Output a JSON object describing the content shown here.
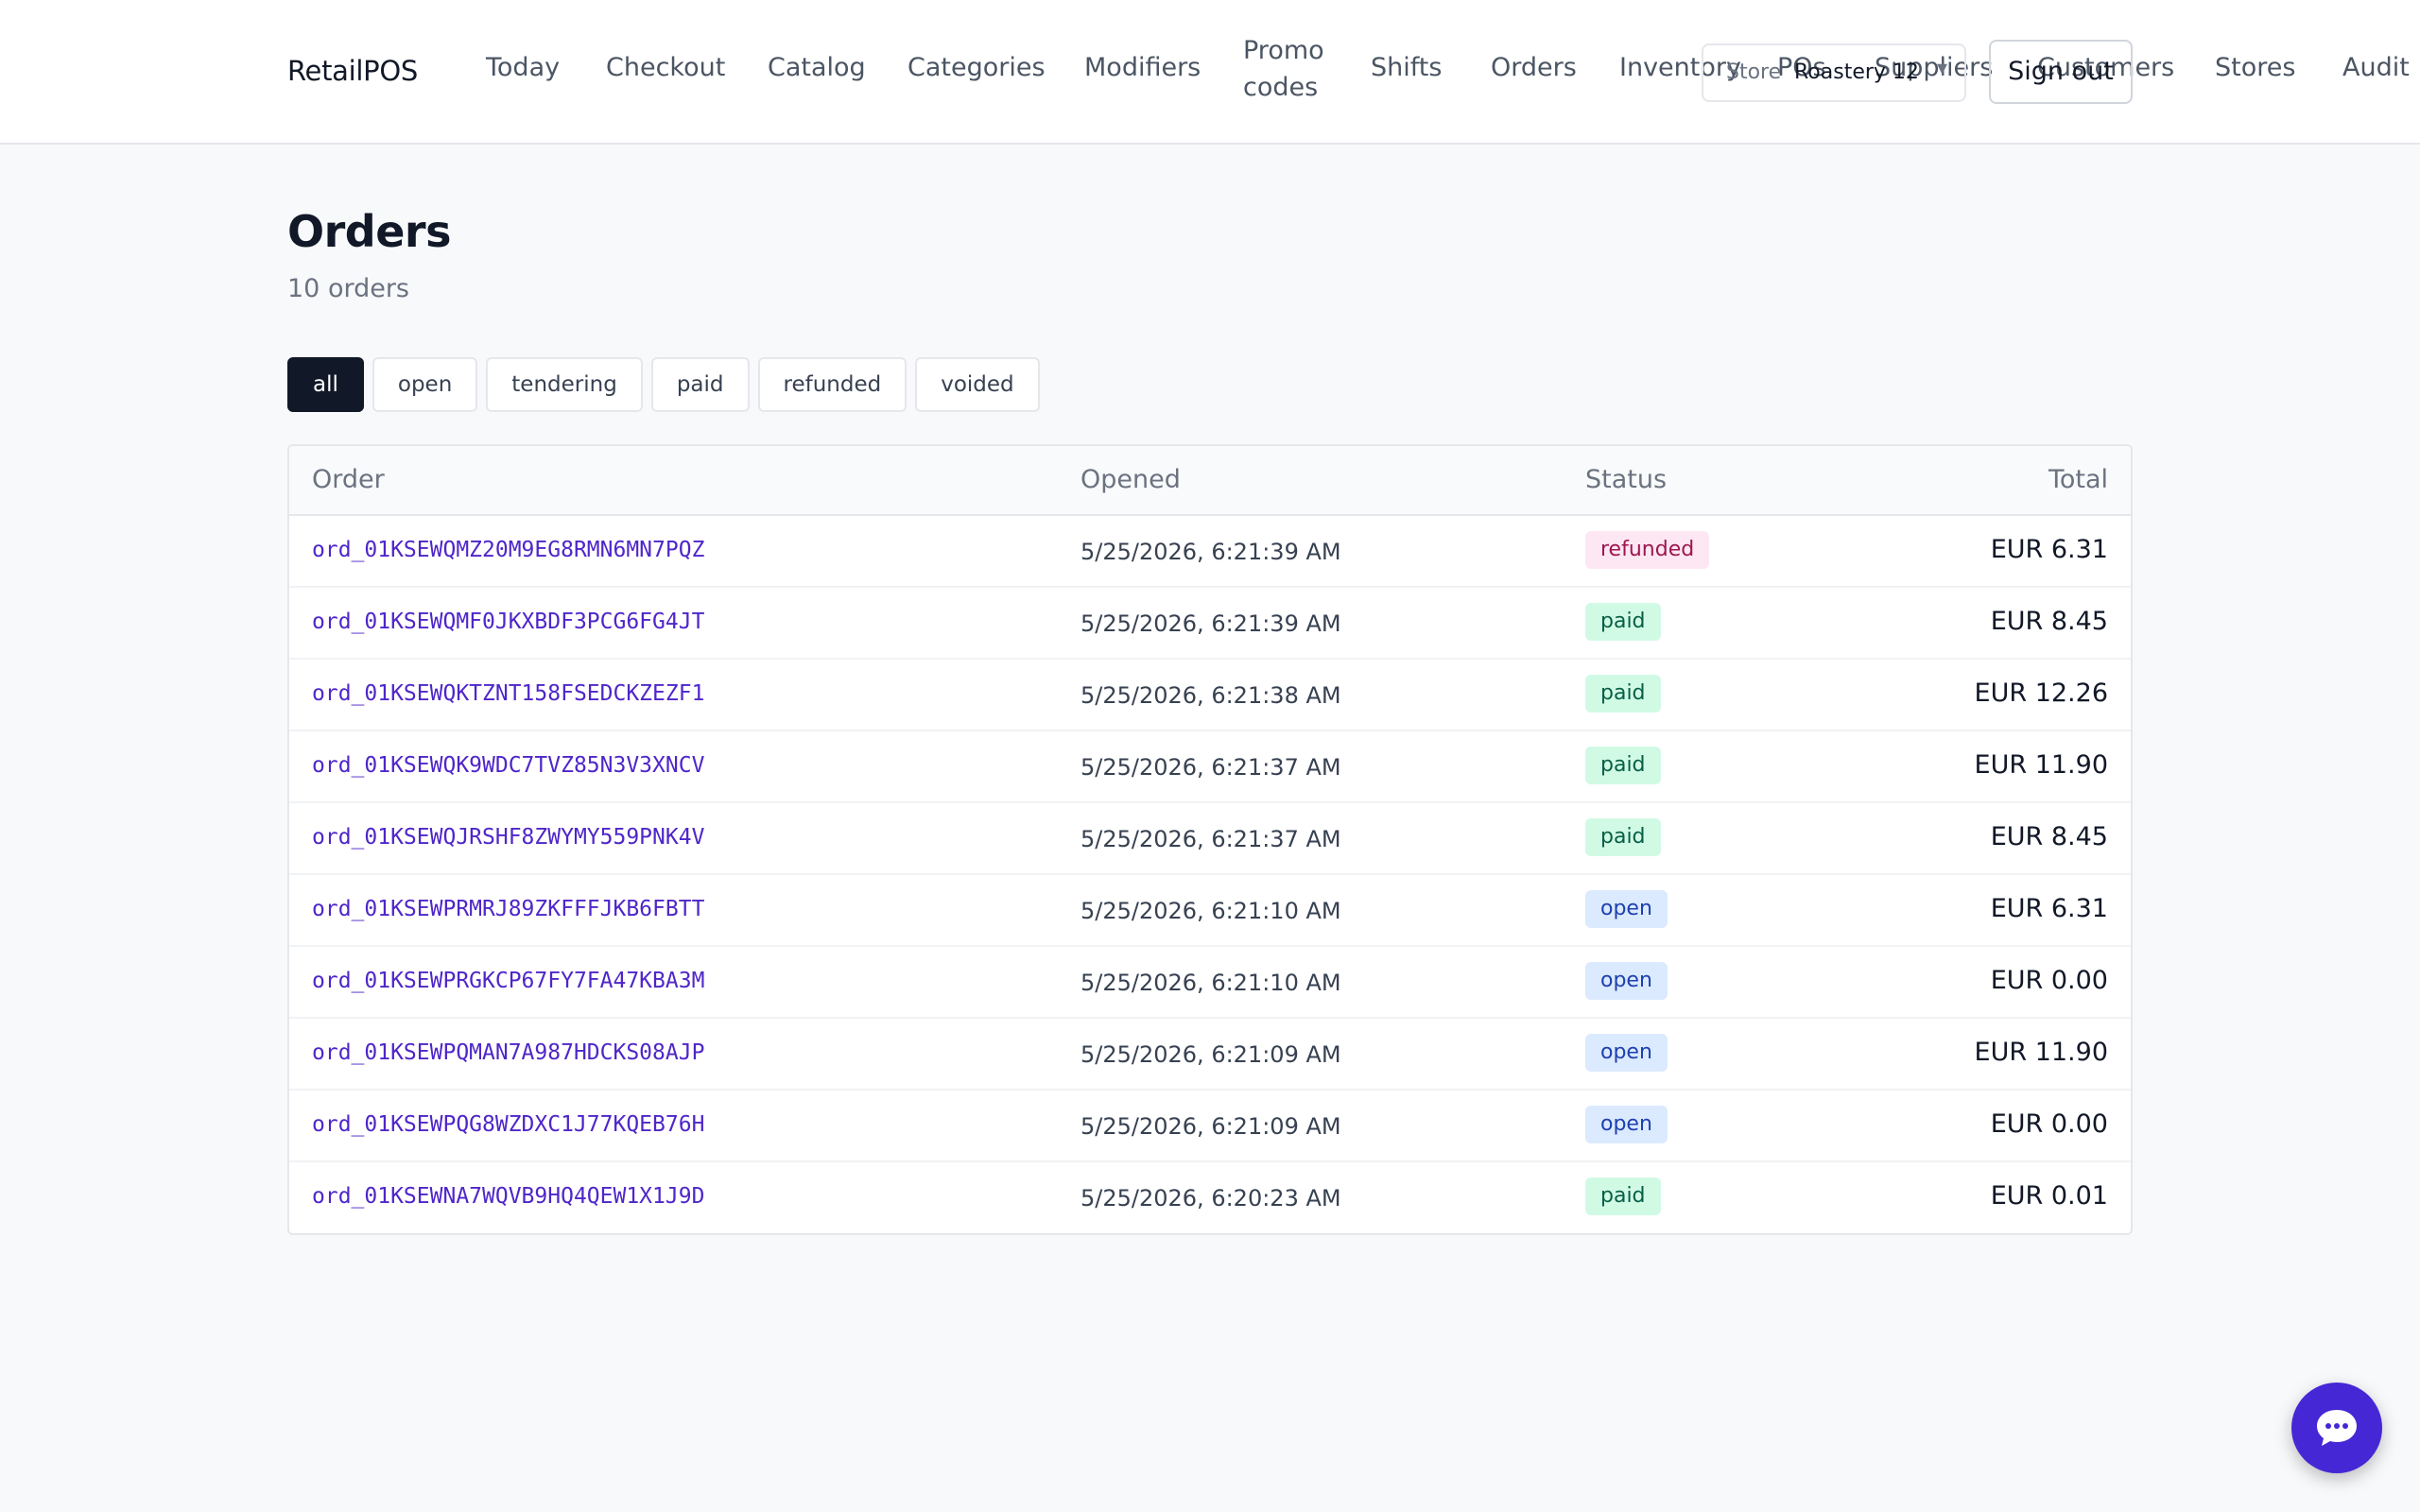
{
  "app": {
    "brand": "RetailPOS"
  },
  "nav": [
    {
      "label": "Today"
    },
    {
      "label": "Checkout"
    },
    {
      "label": "Catalog"
    },
    {
      "label": "Categories"
    },
    {
      "label": "Modifiers"
    },
    {
      "label": "Promo codes"
    },
    {
      "label": "Shifts"
    },
    {
      "label": "Orders"
    },
    {
      "label": "Inventory"
    },
    {
      "label": "POs"
    },
    {
      "label": "Suppliers"
    },
    {
      "label": "Customers"
    },
    {
      "label": "Stores"
    },
    {
      "label": "Audit"
    }
  ],
  "store_select": {
    "label": "Store",
    "value": "Roastery 12",
    "chevron": "chevron-down-icon"
  },
  "signout_label": "Sign out",
  "page": {
    "title": "Orders",
    "subtitle": "10 orders"
  },
  "filters": [
    {
      "label": "all",
      "active": true
    },
    {
      "label": "open"
    },
    {
      "label": "tendering"
    },
    {
      "label": "paid"
    },
    {
      "label": "refunded"
    },
    {
      "label": "voided"
    }
  ],
  "table": {
    "headers": {
      "order": "Order",
      "opened": "Opened",
      "status": "Status",
      "total": "Total"
    },
    "rows": [
      {
        "id": "ord_01KSEWQMZ20M9EG8RMN6MN7PQZ",
        "opened": "5/25/2026, 6:21:39 AM",
        "status": "refunded",
        "total": "EUR 6.31"
      },
      {
        "id": "ord_01KSEWQMF0JKXBDF3PCG6FG4JT",
        "opened": "5/25/2026, 6:21:39 AM",
        "status": "paid",
        "total": "EUR 8.45"
      },
      {
        "id": "ord_01KSEWQKTZNT158FSEDCKZEZF1",
        "opened": "5/25/2026, 6:21:38 AM",
        "status": "paid",
        "total": "EUR 12.26"
      },
      {
        "id": "ord_01KSEWQK9WDC7TVZ85N3V3XNCV",
        "opened": "5/25/2026, 6:21:37 AM",
        "status": "paid",
        "total": "EUR 11.90"
      },
      {
        "id": "ord_01KSEWQJRSHF8ZWYMY559PNK4V",
        "opened": "5/25/2026, 6:21:37 AM",
        "status": "paid",
        "total": "EUR 8.45"
      },
      {
        "id": "ord_01KSEWPRMRJ89ZKFFFJKB6FBTT",
        "opened": "5/25/2026, 6:21:10 AM",
        "status": "open",
        "total": "EUR 6.31"
      },
      {
        "id": "ord_01KSEWPRGKCP67FY7FA47KBA3M",
        "opened": "5/25/2026, 6:21:10 AM",
        "status": "open",
        "total": "EUR 0.00"
      },
      {
        "id": "ord_01KSEWPQMAN7A987HDCKS08AJP",
        "opened": "5/25/2026, 6:21:09 AM",
        "status": "open",
        "total": "EUR 11.90"
      },
      {
        "id": "ord_01KSEWPQG8WZDXC1J77KQEB76H",
        "opened": "5/25/2026, 6:21:09 AM",
        "status": "open",
        "total": "EUR 0.00"
      },
      {
        "id": "ord_01KSEWNA7WQVB9HQ4QEW1X1J9D",
        "opened": "5/25/2026, 6:20:23 AM",
        "status": "paid",
        "total": "EUR 0.01"
      }
    ]
  },
  "chat": {
    "icon": "chat-bubble-icon"
  },
  "colors": {
    "accent": "#4527d6",
    "link": "#4f26c9",
    "dark": "#111827"
  }
}
